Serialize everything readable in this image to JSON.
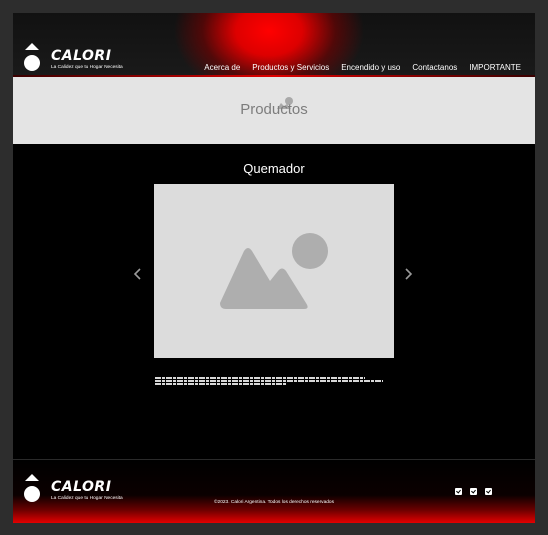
{
  "header": {
    "brand": "CALORI",
    "tagline": "La Calidez que tu Hogar Necesita",
    "nav": [
      {
        "label": "Acerca de"
      },
      {
        "label": "Productos y Servicios"
      },
      {
        "label": "Encendido y uso"
      },
      {
        "label": "Contactanos"
      },
      {
        "label": "IMPORTANTE"
      }
    ]
  },
  "banner": {
    "title": "Productos"
  },
  "gallery": {
    "title": "Quemador",
    "prev_icon": "chevron-left-icon",
    "next_icon": "chevron-right-icon"
  },
  "footer": {
    "brand": "CALORI",
    "tagline": "La Calidez que tu Hogar Necesita",
    "copyright": "©2023. Calori Argentina. Todos los derechos reservados",
    "social_icons": [
      "social-icon-1",
      "social-icon-2",
      "social-icon-3"
    ]
  },
  "colors": {
    "accent": "#ff0000",
    "background": "#000000",
    "banner": "#e4e4e4",
    "placeholder": "#dcdcdc"
  }
}
